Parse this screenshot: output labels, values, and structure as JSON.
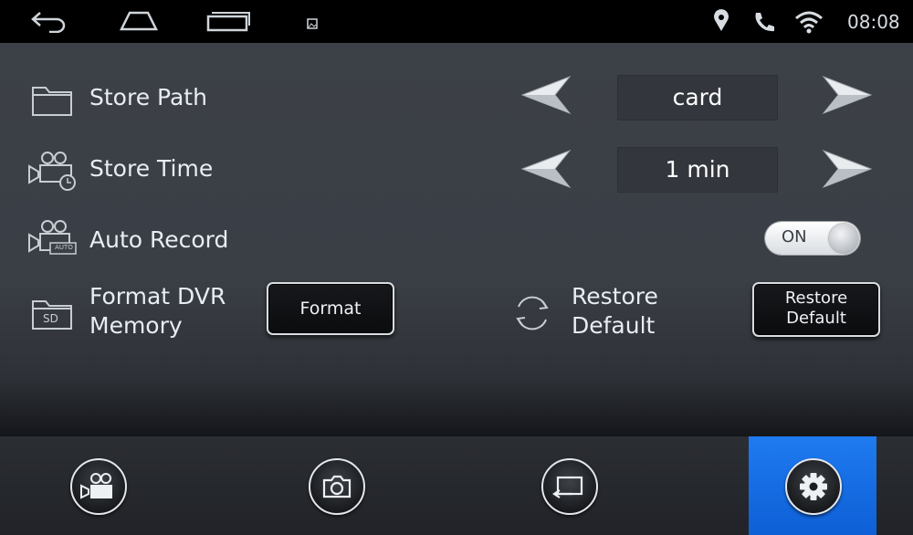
{
  "status_bar": {
    "time": "08:08",
    "icons": [
      "back-icon",
      "home-icon",
      "recents-icon",
      "notification-image-icon",
      "location-pin-icon",
      "phone-icon",
      "wifi-icon"
    ]
  },
  "settings": {
    "store_path": {
      "label": "Store Path",
      "value": "card"
    },
    "store_time": {
      "label": "Store Time",
      "value": "1 min"
    },
    "auto_record": {
      "label": "Auto Record",
      "toggle_text": "ON",
      "state": "on"
    },
    "format": {
      "label_line1": "Format DVR",
      "label_line2": "Memory",
      "button": "Format",
      "sd_icon_text": "SD"
    },
    "restore": {
      "label_line1": "Restore",
      "label_line2": "Default",
      "button_line1": "Restore",
      "button_line2": "Default"
    },
    "auto_icon_text": "AUTO"
  },
  "bottom_nav": {
    "items": [
      "video-record-icon",
      "camera-icon",
      "playback-icon",
      "settings-gear-icon"
    ],
    "active": "settings-gear-icon",
    "active_color": "#1670e8"
  }
}
